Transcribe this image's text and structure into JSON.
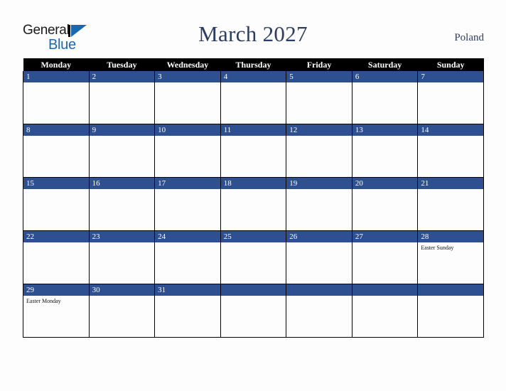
{
  "brand": {
    "name_part1": "General",
    "name_part2": "Blue",
    "triangle_color": "#1668b3",
    "text_color": "#1a1a1a"
  },
  "header": {
    "title": "March 2027",
    "month": "March",
    "year": "2027",
    "region": "Poland",
    "title_color": "#2b3d62"
  },
  "calendar": {
    "weekday_headers": [
      "Monday",
      "Tuesday",
      "Wednesday",
      "Thursday",
      "Friday",
      "Saturday",
      "Sunday"
    ],
    "header_bg": "#000000",
    "header_text": "#ffffff",
    "daynum_bg": "#2e5090",
    "daynum_text": "#ffffff",
    "cell_bg": "#fdfdfd",
    "grid_line": "#000000",
    "weeks": [
      [
        {
          "day": "1",
          "holiday": ""
        },
        {
          "day": "2",
          "holiday": ""
        },
        {
          "day": "3",
          "holiday": ""
        },
        {
          "day": "4",
          "holiday": ""
        },
        {
          "day": "5",
          "holiday": ""
        },
        {
          "day": "6",
          "holiday": ""
        },
        {
          "day": "7",
          "holiday": ""
        }
      ],
      [
        {
          "day": "8",
          "holiday": ""
        },
        {
          "day": "9",
          "holiday": ""
        },
        {
          "day": "10",
          "holiday": ""
        },
        {
          "day": "11",
          "holiday": ""
        },
        {
          "day": "12",
          "holiday": ""
        },
        {
          "day": "13",
          "holiday": ""
        },
        {
          "day": "14",
          "holiday": ""
        }
      ],
      [
        {
          "day": "15",
          "holiday": ""
        },
        {
          "day": "16",
          "holiday": ""
        },
        {
          "day": "17",
          "holiday": ""
        },
        {
          "day": "18",
          "holiday": ""
        },
        {
          "day": "19",
          "holiday": ""
        },
        {
          "day": "20",
          "holiday": ""
        },
        {
          "day": "21",
          "holiday": ""
        }
      ],
      [
        {
          "day": "22",
          "holiday": ""
        },
        {
          "day": "23",
          "holiday": ""
        },
        {
          "day": "24",
          "holiday": ""
        },
        {
          "day": "25",
          "holiday": ""
        },
        {
          "day": "26",
          "holiday": ""
        },
        {
          "day": "27",
          "holiday": ""
        },
        {
          "day": "28",
          "holiday": "Easter Sunday"
        }
      ],
      [
        {
          "day": "29",
          "holiday": "Easter Monday"
        },
        {
          "day": "30",
          "holiday": ""
        },
        {
          "day": "31",
          "holiday": ""
        },
        {
          "day": "",
          "holiday": ""
        },
        {
          "day": "",
          "holiday": ""
        },
        {
          "day": "",
          "holiday": ""
        },
        {
          "day": "",
          "holiday": ""
        }
      ]
    ]
  }
}
